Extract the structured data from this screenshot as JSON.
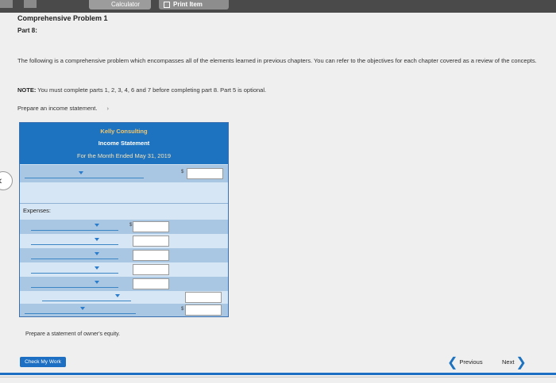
{
  "topbar": {
    "calculator_label": "Calculator",
    "print_label": "Print Item"
  },
  "page": {
    "title": "Comprehensive Problem 1",
    "part": "Part 8:",
    "intro": "The following is a comprehensive problem which encompasses all of the elements learned in previous chapters. You can refer to the objectives for each chapter covered as a review of the concepts.",
    "note_label": "NOTE:",
    "note_text": "You must complete parts 1, 2, 3, 4, 6 and 7 before completing part 8. Part 5 is optional.",
    "prepare_income": "Prepare an income statement.",
    "prepare_equity": "Prepare a statement of owner's equity."
  },
  "statement": {
    "company": "Kelly Consulting",
    "name": "Income Statement",
    "period": "For the Month Ended May 31, 2019",
    "expenses_label": "Expenses:",
    "dollar": "$"
  },
  "nav": {
    "check_label": "Check My Work",
    "previous_label": "Previous",
    "next_label": "Next"
  },
  "colors": {
    "header_blue": "#1e73c0",
    "accent_gold": "#f2c66b"
  }
}
